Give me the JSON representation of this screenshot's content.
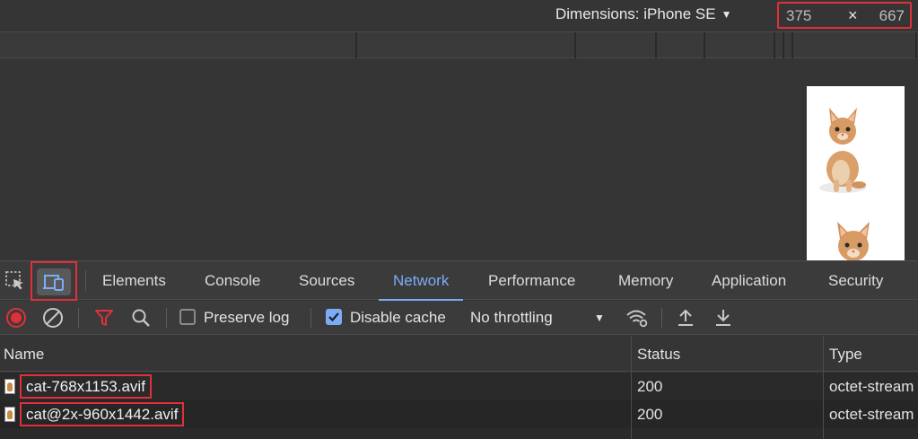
{
  "device_toolbar": {
    "dimensions_label": "Dimensions: iPhone SE",
    "width": "375",
    "separator": "×",
    "height": "667"
  },
  "viewport": {
    "image_description_icon": "cat-image"
  },
  "tabs": [
    {
      "label": "Elements"
    },
    {
      "label": "Console"
    },
    {
      "label": "Sources"
    },
    {
      "label": "Network",
      "active": true
    },
    {
      "label": "Performance"
    },
    {
      "label": "Memory"
    },
    {
      "label": "Application"
    },
    {
      "label": "Security"
    }
  ],
  "network_toolbar": {
    "preserve_log_label": "Preserve log",
    "preserve_log_checked": false,
    "disable_cache_label": "Disable cache",
    "disable_cache_checked": true,
    "throttling_value": "No throttling"
  },
  "table": {
    "columns": [
      "Name",
      "Status",
      "Type"
    ],
    "rows": [
      {
        "name": "cat-768x1153.avif",
        "status": "200",
        "type": "octet-stream"
      },
      {
        "name": "cat@2x-960x1442.avif",
        "status": "200",
        "type": "octet-stream"
      }
    ]
  },
  "colors": {
    "accent": "#7cacf8",
    "highlight_border": "#e0303a",
    "record_red": "#e0303a"
  }
}
